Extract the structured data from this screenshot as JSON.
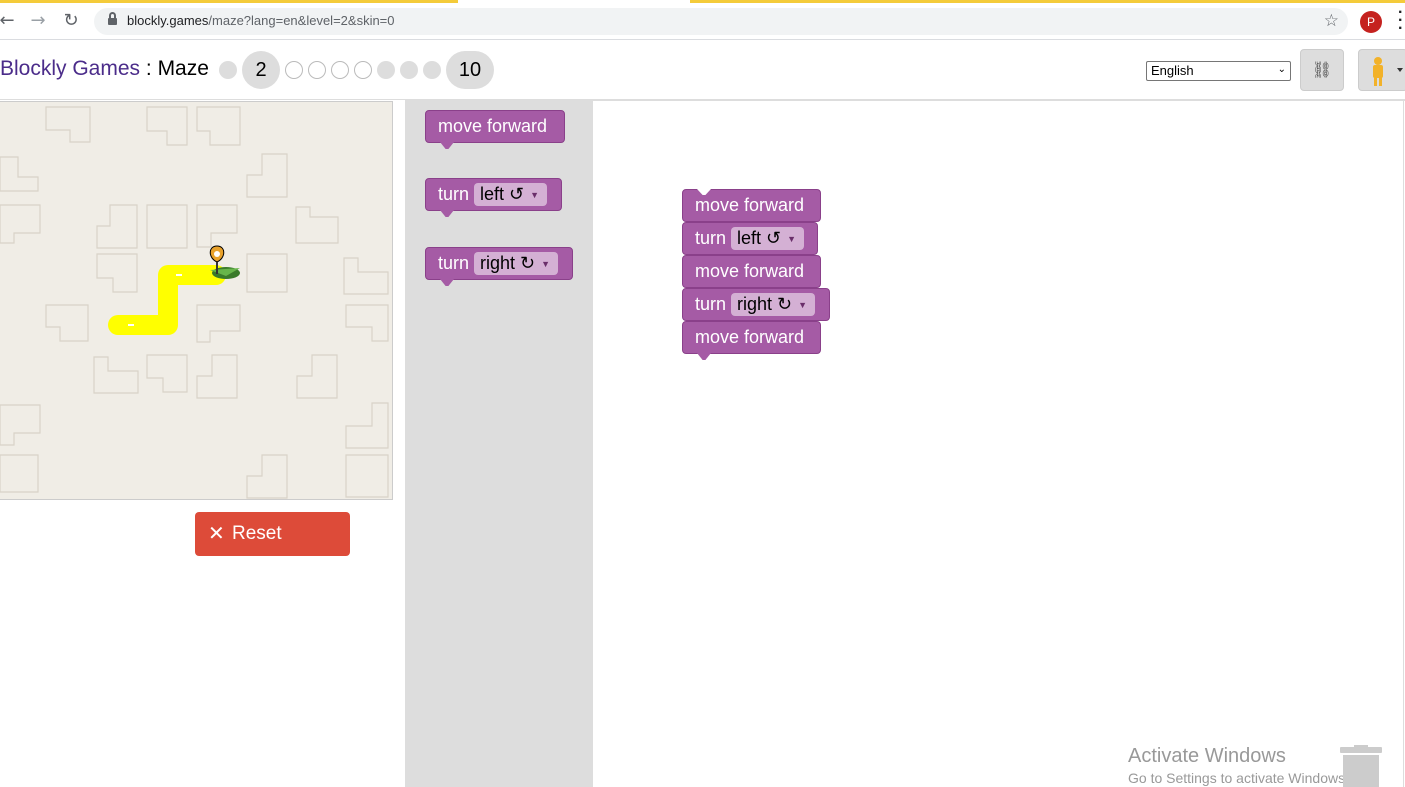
{
  "browser": {
    "url_host": "blockly.games",
    "url_path": "/maze?lang=en&level=2&skin=0",
    "profile_initial": "P"
  },
  "header": {
    "games_link": "Blockly Games",
    "separator": " : ",
    "game_name": "Maze",
    "current_level": "2",
    "last_level": "10",
    "language": "English"
  },
  "maze": {
    "reset_label": "Reset"
  },
  "flyout": {
    "move_forward": "move forward",
    "turn": "turn",
    "left": "left ↺",
    "right": "right ↻"
  },
  "program": [
    {
      "kind": "move",
      "text": "move forward"
    },
    {
      "kind": "turn",
      "text": "turn",
      "dir": "left ↺"
    },
    {
      "kind": "move",
      "text": "move forward"
    },
    {
      "kind": "turn",
      "text": "turn",
      "dir": "right ↻"
    },
    {
      "kind": "move",
      "text": "move forward"
    }
  ],
  "watermark": {
    "line1": "Activate Windows",
    "line2": "Go to Settings to activate Windows."
  },
  "colors": {
    "block": "#a55ba5",
    "reset": "#dd4b39",
    "path": "#ffff00"
  }
}
